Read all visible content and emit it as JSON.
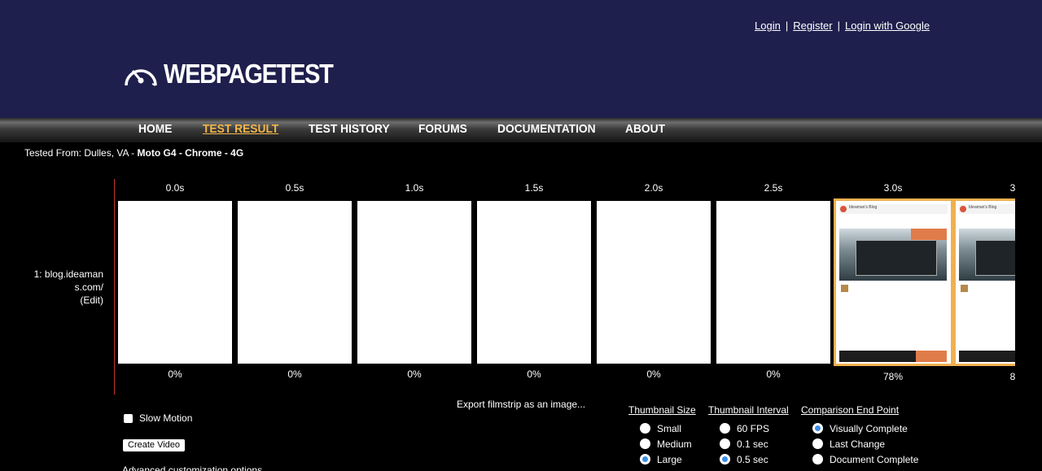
{
  "auth": {
    "login": "Login",
    "register": "Register",
    "login_google": "Login with Google",
    "sep": "|"
  },
  "logo": {
    "text": "WEBPAGETEST",
    "icon": "speedometer-icon"
  },
  "nav": [
    {
      "label": "HOME",
      "active": false
    },
    {
      "label": "TEST RESULT",
      "active": true
    },
    {
      "label": "TEST HISTORY",
      "active": false
    },
    {
      "label": "FORUMS",
      "active": false
    },
    {
      "label": "DOCUMENTATION",
      "active": false
    },
    {
      "label": "ABOUT",
      "active": false
    }
  ],
  "tested_from": {
    "prefix": "Tested From: Dulles, VA - ",
    "config": "Moto G4 - Chrome - 4G"
  },
  "row_label": {
    "line1": "1: blog.ideaman",
    "line2": "s.com/",
    "edit": "(Edit)"
  },
  "filmstrip": [
    {
      "time": "0.0s",
      "pct": "0%",
      "changed": false
    },
    {
      "time": "0.5s",
      "pct": "0%",
      "changed": false
    },
    {
      "time": "1.0s",
      "pct": "0%",
      "changed": false
    },
    {
      "time": "1.5s",
      "pct": "0%",
      "changed": false
    },
    {
      "time": "2.0s",
      "pct": "0%",
      "changed": false
    },
    {
      "time": "2.5s",
      "pct": "0%",
      "changed": false
    },
    {
      "time": "3.0s",
      "pct": "78%",
      "changed": true
    },
    {
      "time": "3",
      "pct": "8",
      "changed": true
    }
  ],
  "thumb_site_title": "Ideaman's Blog",
  "export_link": "Export filmstrip as an image...",
  "slow_motion": {
    "label": "Slow Motion",
    "checked": false
  },
  "create_video": "Create Video",
  "advanced": "Advanced customization options...",
  "thumbnail_size": {
    "title": "Thumbnail Size",
    "options": [
      "Small",
      "Medium",
      "Large"
    ],
    "selected": "Large"
  },
  "thumbnail_interval": {
    "title": "Thumbnail Interval",
    "options": [
      "60 FPS",
      "0.1 sec",
      "0.5 sec"
    ],
    "selected": "0.5 sec"
  },
  "comparison_end": {
    "title": "Comparison End Point",
    "options": [
      "Visually Complete",
      "Last Change",
      "Document Complete"
    ],
    "selected": "Visually Complete"
  },
  "colors": {
    "header_bg": "#1f1f4d",
    "active_nav": "#f2b64a",
    "frame_border": "#f0b050",
    "radio_on": "#3b8ee8",
    "divider": "#c0392b"
  }
}
